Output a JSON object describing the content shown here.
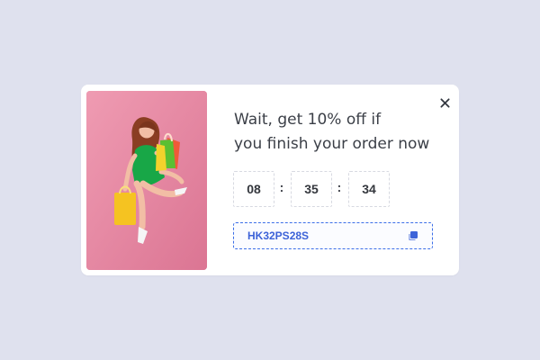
{
  "popup": {
    "headline_line_1": "Wait, get 10% off if",
    "headline_line_2": "you finish your order now",
    "timer": {
      "hours": "08",
      "separator_1": ":",
      "minutes": "35",
      "separator_2": ":",
      "seconds": "34"
    },
    "coupon": {
      "code": "HK32PS28S"
    },
    "icons": {
      "close": "close-icon",
      "copy": "copy-icon"
    },
    "colors": {
      "page_background": "#dfe1ee",
      "popup_background": "#ffffff",
      "text": "#3b3f47",
      "accent": "#3d63d8"
    }
  }
}
